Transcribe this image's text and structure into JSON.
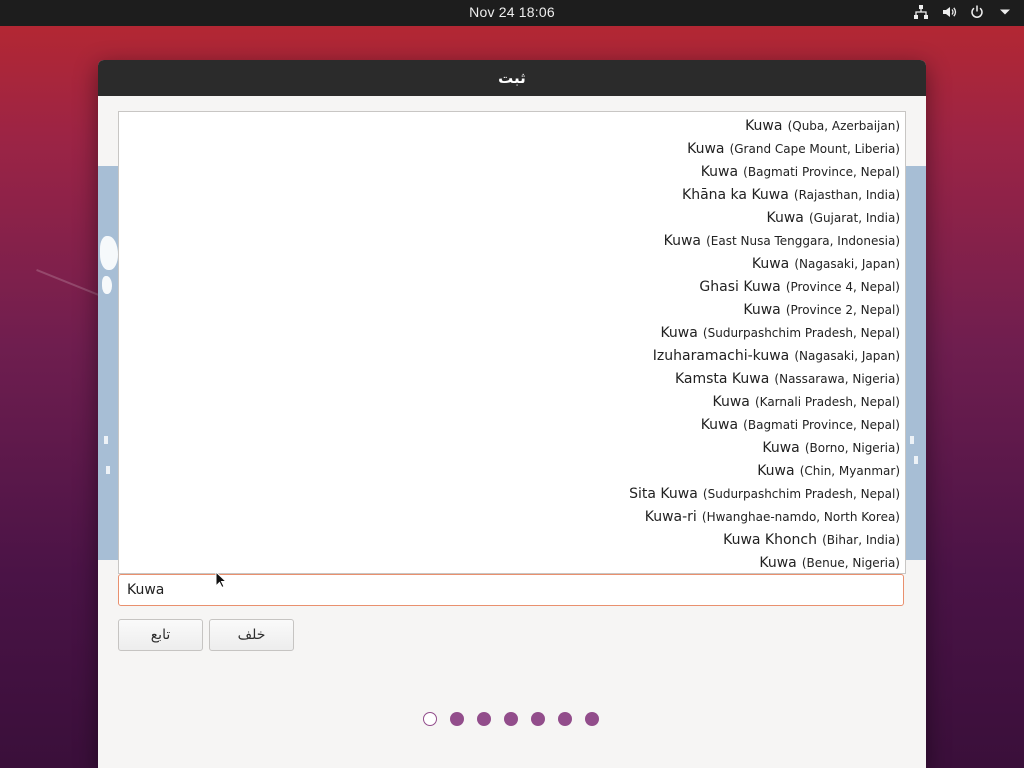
{
  "topbar": {
    "clock": "Nov 24  18:06",
    "icons": [
      "network-icon",
      "volume-icon",
      "power-icon",
      "menu-caret-icon"
    ]
  },
  "window": {
    "title": "ثبت"
  },
  "results": [
    {
      "city": "Kuwa",
      "region": "(Quba, Azerbaijan)"
    },
    {
      "city": "Kuwa",
      "region": "(Grand Cape Mount, Liberia)"
    },
    {
      "city": "Kuwa",
      "region": "(Bagmati Province, Nepal)"
    },
    {
      "city": "Khāna ka Kuwa",
      "region": "(Rajasthan, India)"
    },
    {
      "city": "Kuwa",
      "region": "(Gujarat, India)"
    },
    {
      "city": "Kuwa",
      "region": "(East Nusa Tenggara, Indonesia)"
    },
    {
      "city": "Kuwa",
      "region": "(Nagasaki, Japan)"
    },
    {
      "city": "Ghasi Kuwa",
      "region": "(Province 4, Nepal)"
    },
    {
      "city": "Kuwa",
      "region": "(Province 2, Nepal)"
    },
    {
      "city": "Kuwa",
      "region": "(Sudurpashchim Pradesh, Nepal)"
    },
    {
      "city": "Izuharamachi-kuwa",
      "region": "(Nagasaki, Japan)"
    },
    {
      "city": "Kamsta Kuwa",
      "region": "(Nassarawa, Nigeria)"
    },
    {
      "city": "Kuwa",
      "region": "(Karnali Pradesh, Nepal)"
    },
    {
      "city": "Kuwa",
      "region": "(Bagmati Province, Nepal)"
    },
    {
      "city": "Kuwa",
      "region": "(Borno, Nigeria)"
    },
    {
      "city": "Kuwa",
      "region": "(Chin, Myanmar)"
    },
    {
      "city": "Sita Kuwa",
      "region": "(Sudurpashchim Pradesh, Nepal)"
    },
    {
      "city": "Kuwa-ri",
      "region": "(Hwanghae-namdo, North Korea)"
    },
    {
      "city": "Kuwa Khonch",
      "region": "(Bihar, India)"
    },
    {
      "city": "Kuwa",
      "region": "(Benue, Nigeria)"
    }
  ],
  "search": {
    "value": "Kuwa"
  },
  "buttons": {
    "continue_label": "تابع",
    "back_label": "خلف"
  },
  "progress": {
    "total_steps": 7,
    "current_step": 1
  },
  "colors": {
    "accent": "#924d8b",
    "focus_border": "#e9906e",
    "titlebar": "#2b2b2b",
    "topbar": "#1d1d1d"
  }
}
